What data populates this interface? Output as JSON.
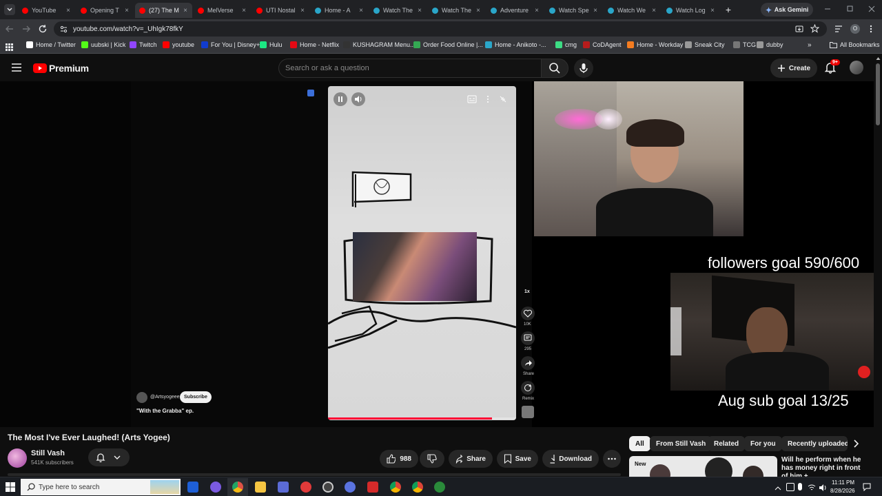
{
  "browser": {
    "tabs": [
      {
        "label": "YouTube",
        "icon": "youtube-icon"
      },
      {
        "label": "Opening T",
        "icon": "youtube-icon"
      },
      {
        "label": "(27) The M",
        "icon": "youtube-icon"
      },
      {
        "label": "MelVerse",
        "icon": "youtube-icon"
      },
      {
        "label": "UTI Nostal",
        "icon": "youtube-icon"
      },
      {
        "label": "Home - A",
        "icon": "globe-icon"
      },
      {
        "label": "Watch The",
        "icon": "globe-icon"
      },
      {
        "label": "Watch The",
        "icon": "globe-icon"
      },
      {
        "label": "Adventure",
        "icon": "globe-icon"
      },
      {
        "label": "Watch Spe",
        "icon": "globe-icon"
      },
      {
        "label": "Watch We",
        "icon": "globe-icon"
      },
      {
        "label": "Watch Log",
        "icon": "globe-icon"
      }
    ],
    "active_tab": 2,
    "new_tab": "+",
    "ask_gemini": "Ask Gemini",
    "url": "youtube.com/watch?v=_UhIgk78fkY",
    "bookmarks": [
      "Home / Twitter",
      "uubski | Kick",
      "Twitch",
      "youtube",
      "For You | Disney+",
      "Hulu",
      "Home - Netflix",
      "KUSHAGRAM Menu...",
      "Order Food Online |...",
      "Home - Anikoto -...",
      "cmg",
      "CoDAgent",
      "Home - Workday",
      "Sneak City",
      "TCG",
      "dubby"
    ],
    "bookmarks_more": "»",
    "all_bookmarks": "All Bookmarks",
    "profile_initial": "O"
  },
  "youtube": {
    "logo": "Premium",
    "search_placeholder": "Search or ask a question",
    "create": "Create",
    "notifications": "9+",
    "video": {
      "title": "The Most I've Ever Laughed! (Arts Yogee)",
      "channel": "Still Vash",
      "subscribers": "541K subscribers",
      "likes": "988",
      "share": "Share",
      "save": "Save",
      "download": "Download"
    },
    "short": {
      "handle": "@Artsyogeee",
      "subscribe": "Subscribe",
      "caption": "\"With the Grabba\" ep.",
      "speed": "1x",
      "like_count": "10K",
      "comment_count": "295",
      "share": "Share",
      "remix": "Remix"
    },
    "overlay": {
      "followers_goal": "followers goal 590/600",
      "sub_goal": "Aug sub goal 13/25"
    },
    "chips": [
      "All",
      "From Still Vash",
      "Related",
      "For you",
      "Recently uploaded"
    ],
    "recommended": {
      "badge": "New",
      "title": "Will he perform when he has money right in front of him +"
    }
  },
  "taskbar": {
    "search_placeholder": "Type here to search",
    "time": "11:11 PM",
    "date": "8/28/2026"
  }
}
